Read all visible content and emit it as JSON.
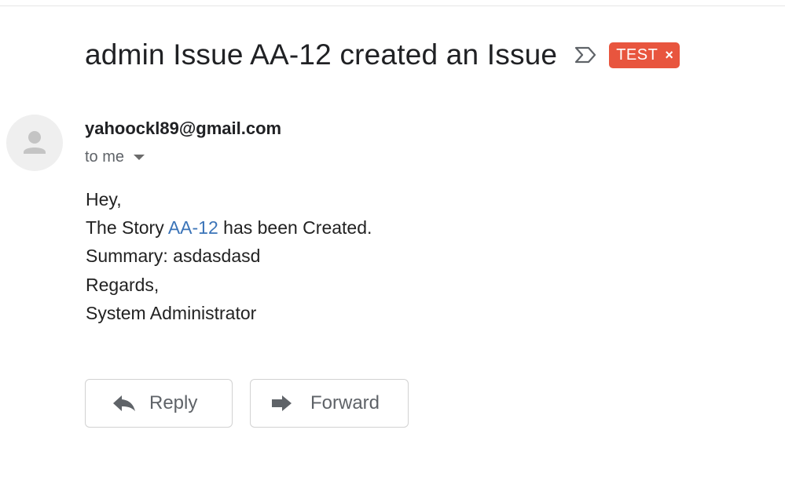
{
  "email": {
    "subject": "admin Issue AA-12 created an Issue",
    "label": "TEST",
    "label_remove": "×",
    "sender": "yahoockl89@gmail.com",
    "recipient": "to me",
    "body": {
      "greeting": "Hey,",
      "line2_prefix": "The Story ",
      "link_text": "AA-12",
      "line2_suffix": " has been Created.",
      "summary": "Summary: asdasdasd",
      "closing": "Regards,",
      "signature": "System Administrator"
    }
  },
  "actions": {
    "reply_label": "Reply",
    "forward_label": "Forward"
  },
  "icons": {
    "importance": "importance-marker-icon",
    "avatar": "person-icon",
    "recipient_toggle": "caret-down-icon",
    "reply": "reply-arrow-icon",
    "forward": "forward-arrow-icon",
    "label_remove": "close-icon"
  },
  "colors": {
    "label_bg": "#e8553e",
    "link": "#3b74b8",
    "text_muted": "#5f6368"
  }
}
